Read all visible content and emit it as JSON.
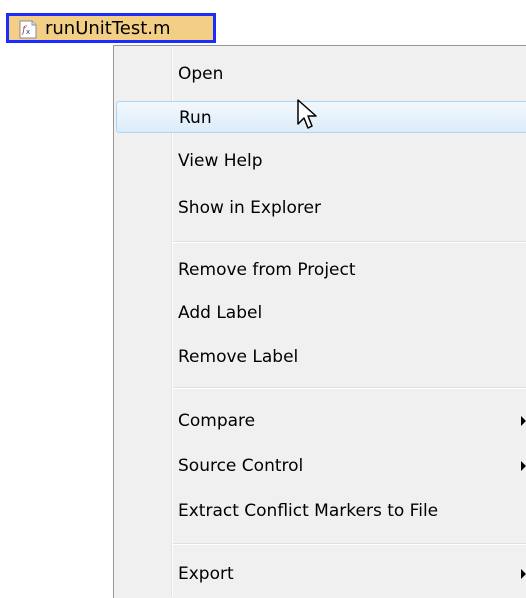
{
  "file": {
    "name": "runUnitTest.m",
    "icon": "matlab-function-file-icon"
  },
  "menu": {
    "items": [
      {
        "label": "Open"
      },
      {
        "label": "Run"
      },
      {
        "label": "View Help"
      },
      {
        "label": "Show in Explorer"
      },
      {
        "label": "Remove from Project"
      },
      {
        "label": "Add Label"
      },
      {
        "label": "Remove Label"
      },
      {
        "label": "Compare"
      },
      {
        "label": "Source Control"
      },
      {
        "label": "Extract Conflict Markers to File"
      },
      {
        "label": "Export"
      }
    ],
    "hovered_item": "Run",
    "submenu_items": [
      "Compare",
      "Source Control",
      "Export"
    ]
  },
  "colors": {
    "selection_border": "#1c2cff",
    "selection_fill": "#f3cf86",
    "menu_background": "#f0f0f0",
    "hover_border": "#a8d8f5",
    "hover_fill": "#dcecfa"
  },
  "cursor": {
    "icon": "mouse-pointer-icon"
  }
}
